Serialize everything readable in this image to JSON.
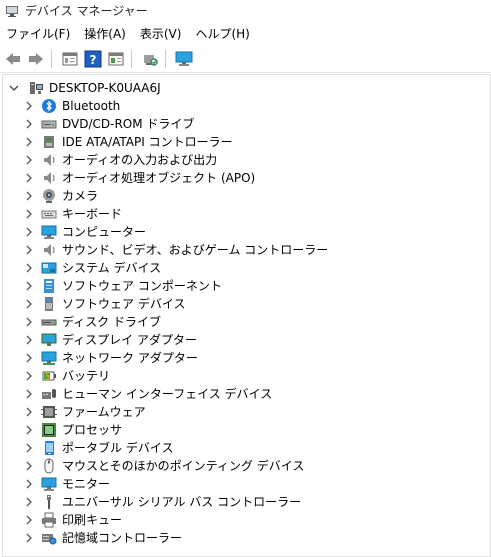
{
  "window": {
    "title": "デバイス マネージャー"
  },
  "menu": [
    "ファイル(F)",
    "操作(A)",
    "表示(V)",
    "ヘルプ(H)"
  ],
  "toolbar": {
    "buttons": [
      "back-icon",
      "forward-icon",
      "properties-icon",
      "help-icon",
      "view-icon",
      "scan-icon",
      "monitor-icon"
    ]
  },
  "tree": {
    "root": "DESKTOP-K0UAA6J",
    "items": [
      {
        "label": "Bluetooth",
        "icon": "bluetooth-icon"
      },
      {
        "label": "DVD/CD-ROM ドライブ",
        "icon": "dvd-drive-icon"
      },
      {
        "label": "IDE ATA/ATAPI コントローラー",
        "icon": "ide-controller-icon"
      },
      {
        "label": "オーディオの入力および出力",
        "icon": "audio-icon"
      },
      {
        "label": "オーディオ処理オブジェクト (APO)",
        "icon": "audio-icon"
      },
      {
        "label": "カメラ",
        "icon": "camera-icon"
      },
      {
        "label": "キーボード",
        "icon": "keyboard-icon"
      },
      {
        "label": "コンピューター",
        "icon": "computer-icon"
      },
      {
        "label": "サウンド、ビデオ、およびゲーム コントローラー",
        "icon": "audio-icon"
      },
      {
        "label": "システム デバイス",
        "icon": "system-device-icon"
      },
      {
        "label": "ソフトウェア コンポーネント",
        "icon": "software-component-icon"
      },
      {
        "label": "ソフトウェア デバイス",
        "icon": "software-device-icon"
      },
      {
        "label": "ディスク ドライブ",
        "icon": "disk-drive-icon"
      },
      {
        "label": "ディスプレイ アダプター",
        "icon": "display-adapter-icon"
      },
      {
        "label": "ネットワーク アダプター",
        "icon": "network-adapter-icon"
      },
      {
        "label": "バッテリ",
        "icon": "battery-icon"
      },
      {
        "label": "ヒューマン インターフェイス デバイス",
        "icon": "hid-icon"
      },
      {
        "label": "ファームウェア",
        "icon": "firmware-icon"
      },
      {
        "label": "プロセッサ",
        "icon": "processor-icon"
      },
      {
        "label": "ポータブル デバイス",
        "icon": "portable-device-icon"
      },
      {
        "label": "マウスとそのほかのポインティング デバイス",
        "icon": "mouse-icon"
      },
      {
        "label": "モニター",
        "icon": "monitor-icon"
      },
      {
        "label": "ユニバーサル シリアル バス コントローラー",
        "icon": "usb-icon"
      },
      {
        "label": "印刷キュー",
        "icon": "printer-icon"
      },
      {
        "label": "記憶域コントローラー",
        "icon": "storage-controller-icon"
      }
    ]
  }
}
